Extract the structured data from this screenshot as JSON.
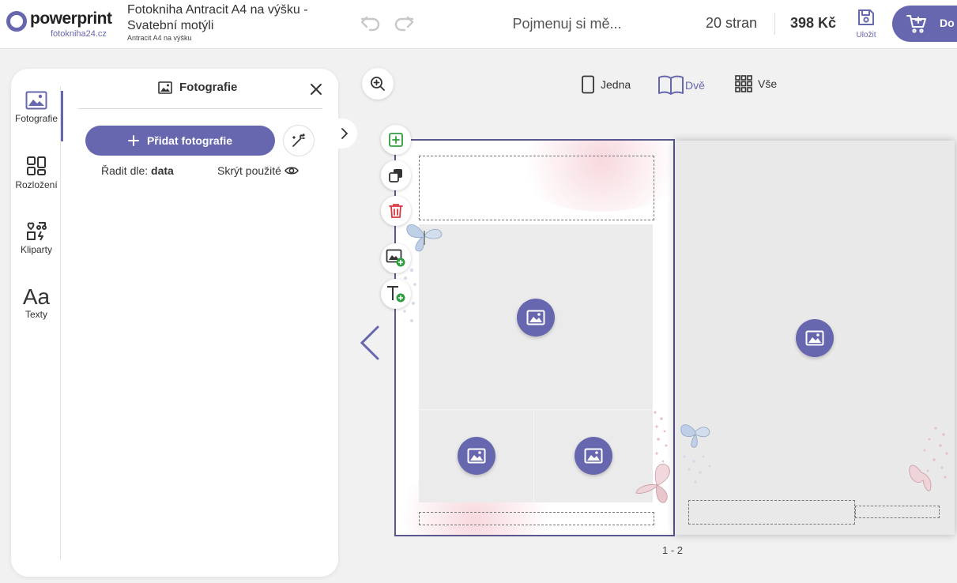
{
  "header": {
    "logo_text": "powerprint",
    "logo_sub": "fotokniha24.cz",
    "title": "Fotokniha Antracit A4 na výšku - Svatební motýli",
    "subtitle": "Antracit A4 na výšku",
    "name_placeholder": "Pojmenuj si mě...",
    "pages": "20 stran",
    "price": "398 Kč",
    "save_label": "Uložit",
    "cart_label": "Do k"
  },
  "sidebar": {
    "items": [
      {
        "label": "Fotografie",
        "icon": "image-icon"
      },
      {
        "label": "Rozložení",
        "icon": "layout-icon"
      },
      {
        "label": "Kliparty",
        "icon": "clipart-icon"
      },
      {
        "label": "Texty",
        "icon": "text-icon",
        "glyph": "Aa"
      }
    ]
  },
  "panel": {
    "title": "Fotografie",
    "add_button": "Přidat fotografie",
    "sort_label": "Řadit dle:",
    "sort_value": "data",
    "hide_used": "Skrýt použité"
  },
  "view": {
    "options": [
      "Jedna",
      "Dvě",
      "Vše"
    ],
    "active": "Dvě"
  },
  "page_indicator": "1 - 2",
  "colors": {
    "accent": "#6767b0",
    "delete": "#d9363e",
    "add": "#2e9d3e"
  }
}
